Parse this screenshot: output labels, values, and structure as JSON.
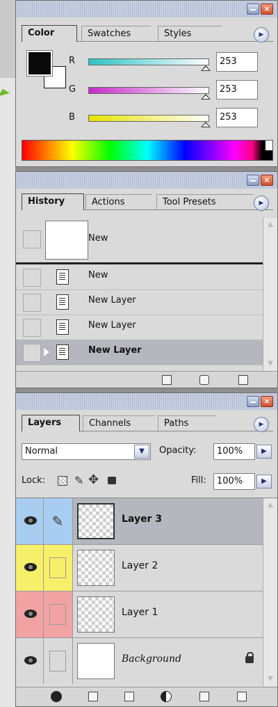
{
  "color_panel": {
    "tabs": [
      "Color",
      "Swatches",
      "Styles"
    ],
    "active_tab": "Color",
    "sliders": [
      {
        "label": "R",
        "value": "253"
      },
      {
        "label": "G",
        "value": "253"
      },
      {
        "label": "B",
        "value": "253"
      }
    ],
    "foreground_color": "#090909",
    "background_color": "#fdfdfd"
  },
  "history_panel": {
    "tabs": [
      "History",
      "Actions",
      "Tool Presets"
    ],
    "active_tab": "History",
    "snapshot_label": "New",
    "items": [
      "New",
      "New Layer",
      "New Layer",
      "New Layer"
    ],
    "selected_index": 3
  },
  "layers_panel": {
    "tabs": [
      "Layers",
      "Channels",
      "Paths"
    ],
    "active_tab": "Layers",
    "blend_mode": "Normal",
    "opacity_label": "Opacity:",
    "opacity_value": "100%",
    "lock_label": "Lock:",
    "fill_label": "Fill:",
    "fill_value": "100%",
    "layers": [
      {
        "name": "Layer 3",
        "color": "#a9cdf0",
        "selected": true
      },
      {
        "name": "Layer 2",
        "color": "#f6ef6a",
        "selected": false
      },
      {
        "name": "Layer 1",
        "color": "#f1a3a3",
        "selected": false
      },
      {
        "name": "Background",
        "color": "#dadada",
        "selected": false
      }
    ]
  },
  "icons": [
    "minimize-icon",
    "close-icon",
    "panel-menu-icon",
    "eye-icon",
    "brush-icon",
    "lock-icon",
    "trash-icon",
    "new-document-icon",
    "camera-icon",
    "folder-icon",
    "mask-icon",
    "adjustment-icon",
    "layer-style-icon"
  ]
}
